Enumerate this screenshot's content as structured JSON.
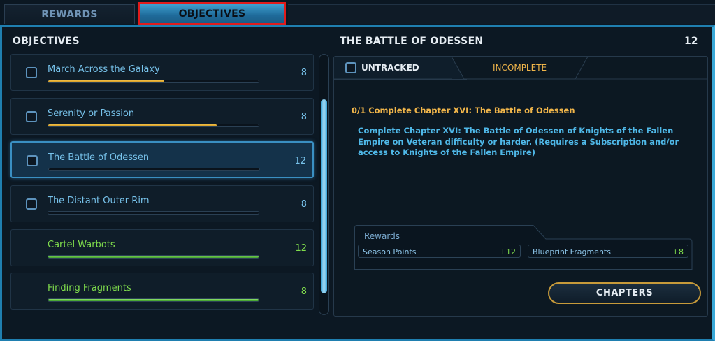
{
  "tabs": [
    {
      "label": "REWARDS",
      "active": false
    },
    {
      "label": "OBJECTIVES",
      "active": true
    }
  ],
  "objectives_header": "OBJECTIVES",
  "objectives": [
    {
      "name": "March Across the Galaxy",
      "points": "8",
      "progress": 0.55,
      "color": "gold",
      "checkbox": true,
      "selected": false
    },
    {
      "name": "Serenity or Passion",
      "points": "8",
      "progress": 0.8,
      "color": "gold",
      "checkbox": true,
      "selected": false
    },
    {
      "name": "The Battle of Odessen",
      "points": "12",
      "progress": 0.0,
      "color": "gold",
      "checkbox": true,
      "selected": true
    },
    {
      "name": "The Distant Outer Rim",
      "points": "8",
      "progress": 0.0,
      "color": "gold",
      "checkbox": true,
      "selected": false
    },
    {
      "name": "Cartel Warbots",
      "points": "12",
      "progress": 1.0,
      "color": "green",
      "checkbox": false,
      "selected": false
    },
    {
      "name": "Finding Fragments",
      "points": "8",
      "progress": 1.0,
      "color": "green",
      "checkbox": false,
      "selected": false
    }
  ],
  "detail": {
    "title": "THE BATTLE OF ODESSEN",
    "points": "12",
    "tracked_label": "UNTRACKED",
    "status": "INCOMPLETE",
    "task": "0/1 Complete Chapter XVI: The Battle of Odessen",
    "description": "Complete Chapter XVI: The Battle of Odessen of Knights of the Fallen Empire on Veteran difficulty or harder. (Requires a Subscription and/or access to Knights of the Fallen Empire)",
    "rewards_label": "Rewards",
    "rewards": [
      {
        "name": "Season Points",
        "value": "+12"
      },
      {
        "name": "Blueprint Fragments",
        "value": "+8"
      }
    ],
    "chapters_label": "CHAPTERS"
  },
  "colors": {
    "accent": "#3aa3d8",
    "gold": "#f0b54a",
    "green": "#7fdc4c",
    "highlight": "#e11b1b"
  }
}
